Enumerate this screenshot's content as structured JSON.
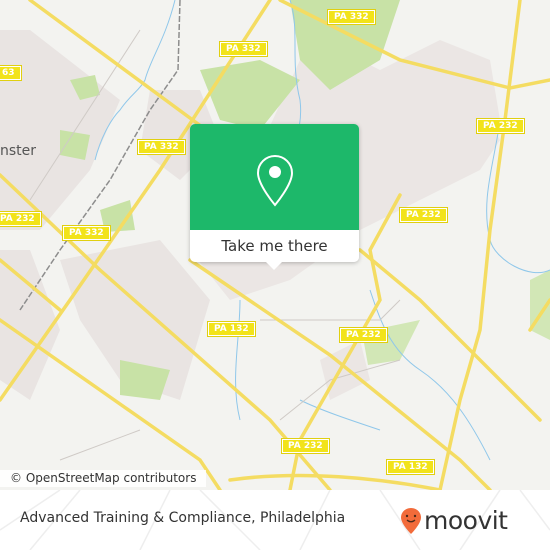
{
  "map": {
    "place_labels": [
      {
        "text": "nster"
      }
    ],
    "route_shields": [
      {
        "text": "PA 332"
      },
      {
        "text": "PA 332"
      },
      {
        "text": "PA 332"
      },
      {
        "text": "PA 332"
      },
      {
        "text": "63"
      },
      {
        "text": "PA 232"
      },
      {
        "text": "PA 232"
      },
      {
        "text": "PA 232"
      },
      {
        "text": "PA 232"
      },
      {
        "text": "PA 232"
      },
      {
        "text": "PA 132"
      },
      {
        "text": "PA 132"
      }
    ],
    "colors": {
      "background": "#f3f3f0",
      "residential": "#e9e4e2",
      "park": "#c8e2a6",
      "road": "#f4dc62",
      "water": "#8fc7ea",
      "shield": "#f2e31a"
    }
  },
  "popup": {
    "icon": "map-pin-icon",
    "button_label": "Take me there",
    "color": "#1db86a"
  },
  "attribution": "© OpenStreetMap contributors",
  "footer": {
    "title": "Advanced Training & Compliance, Philadelphia",
    "logo_text": "moovit",
    "logo_color": "#f26b3a"
  }
}
